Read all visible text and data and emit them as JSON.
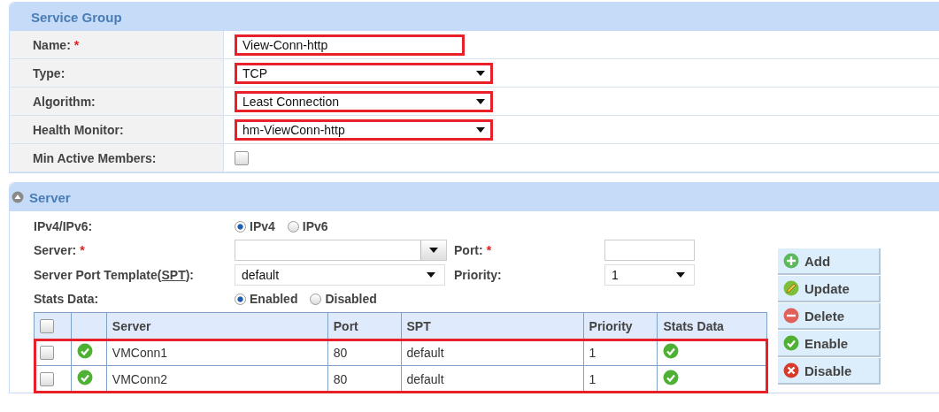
{
  "service_group": {
    "title": "Service Group",
    "fields": [
      {
        "kind": "text",
        "label": "Name:",
        "required_mark": "*",
        "value": "View-Conn-http",
        "highlighted": true
      },
      {
        "kind": "select",
        "label": "Type:",
        "value": "TCP",
        "highlighted": true
      },
      {
        "kind": "select",
        "label": "Algorithm:",
        "value": "Least Connection",
        "highlighted": true
      },
      {
        "kind": "select",
        "label": "Health Monitor:",
        "value": "hm-ViewConn-http",
        "highlighted": true
      },
      {
        "kind": "checkbox",
        "label": "Min Active Members:",
        "checked": false
      }
    ]
  },
  "server": {
    "title": "Server",
    "ip_version": {
      "label": "IPv4/IPv6:",
      "options": [
        {
          "label": "IPv4",
          "selected": true
        },
        {
          "label": "IPv6",
          "selected": false
        }
      ]
    },
    "server_field": {
      "label": "Server:",
      "required_mark": "*"
    },
    "port_field": {
      "label": "Port:",
      "required_mark": "*"
    },
    "spt": {
      "label": "Server Port Template(",
      "link": "SPT",
      "label_end": "):",
      "value": "default"
    },
    "priority": {
      "label": "Priority:",
      "value": "1"
    },
    "stats_data": {
      "label": "Stats Data:",
      "options": [
        {
          "label": "Enabled",
          "selected": true
        },
        {
          "label": "Disabled",
          "selected": false
        }
      ]
    },
    "table": {
      "header_checked": false,
      "highlighted": true,
      "columns": [
        "Server",
        "Port",
        "SPT",
        "Priority",
        "Stats Data"
      ],
      "rows": [
        {
          "checked": false,
          "active": true,
          "server": "VMConn1",
          "port": "80",
          "spt": "default",
          "priority": "1",
          "stats_enabled": true
        },
        {
          "checked": false,
          "active": true,
          "server": "VMConn2",
          "port": "80",
          "spt": "default",
          "priority": "1",
          "stats_enabled": true
        }
      ]
    },
    "buttons": [
      {
        "kind": "add",
        "label": "Add"
      },
      {
        "kind": "update",
        "label": "Update"
      },
      {
        "kind": "delete",
        "label": "Delete"
      },
      {
        "kind": "enable",
        "label": "Enable"
      },
      {
        "kind": "disable",
        "label": "Disable"
      }
    ]
  }
}
